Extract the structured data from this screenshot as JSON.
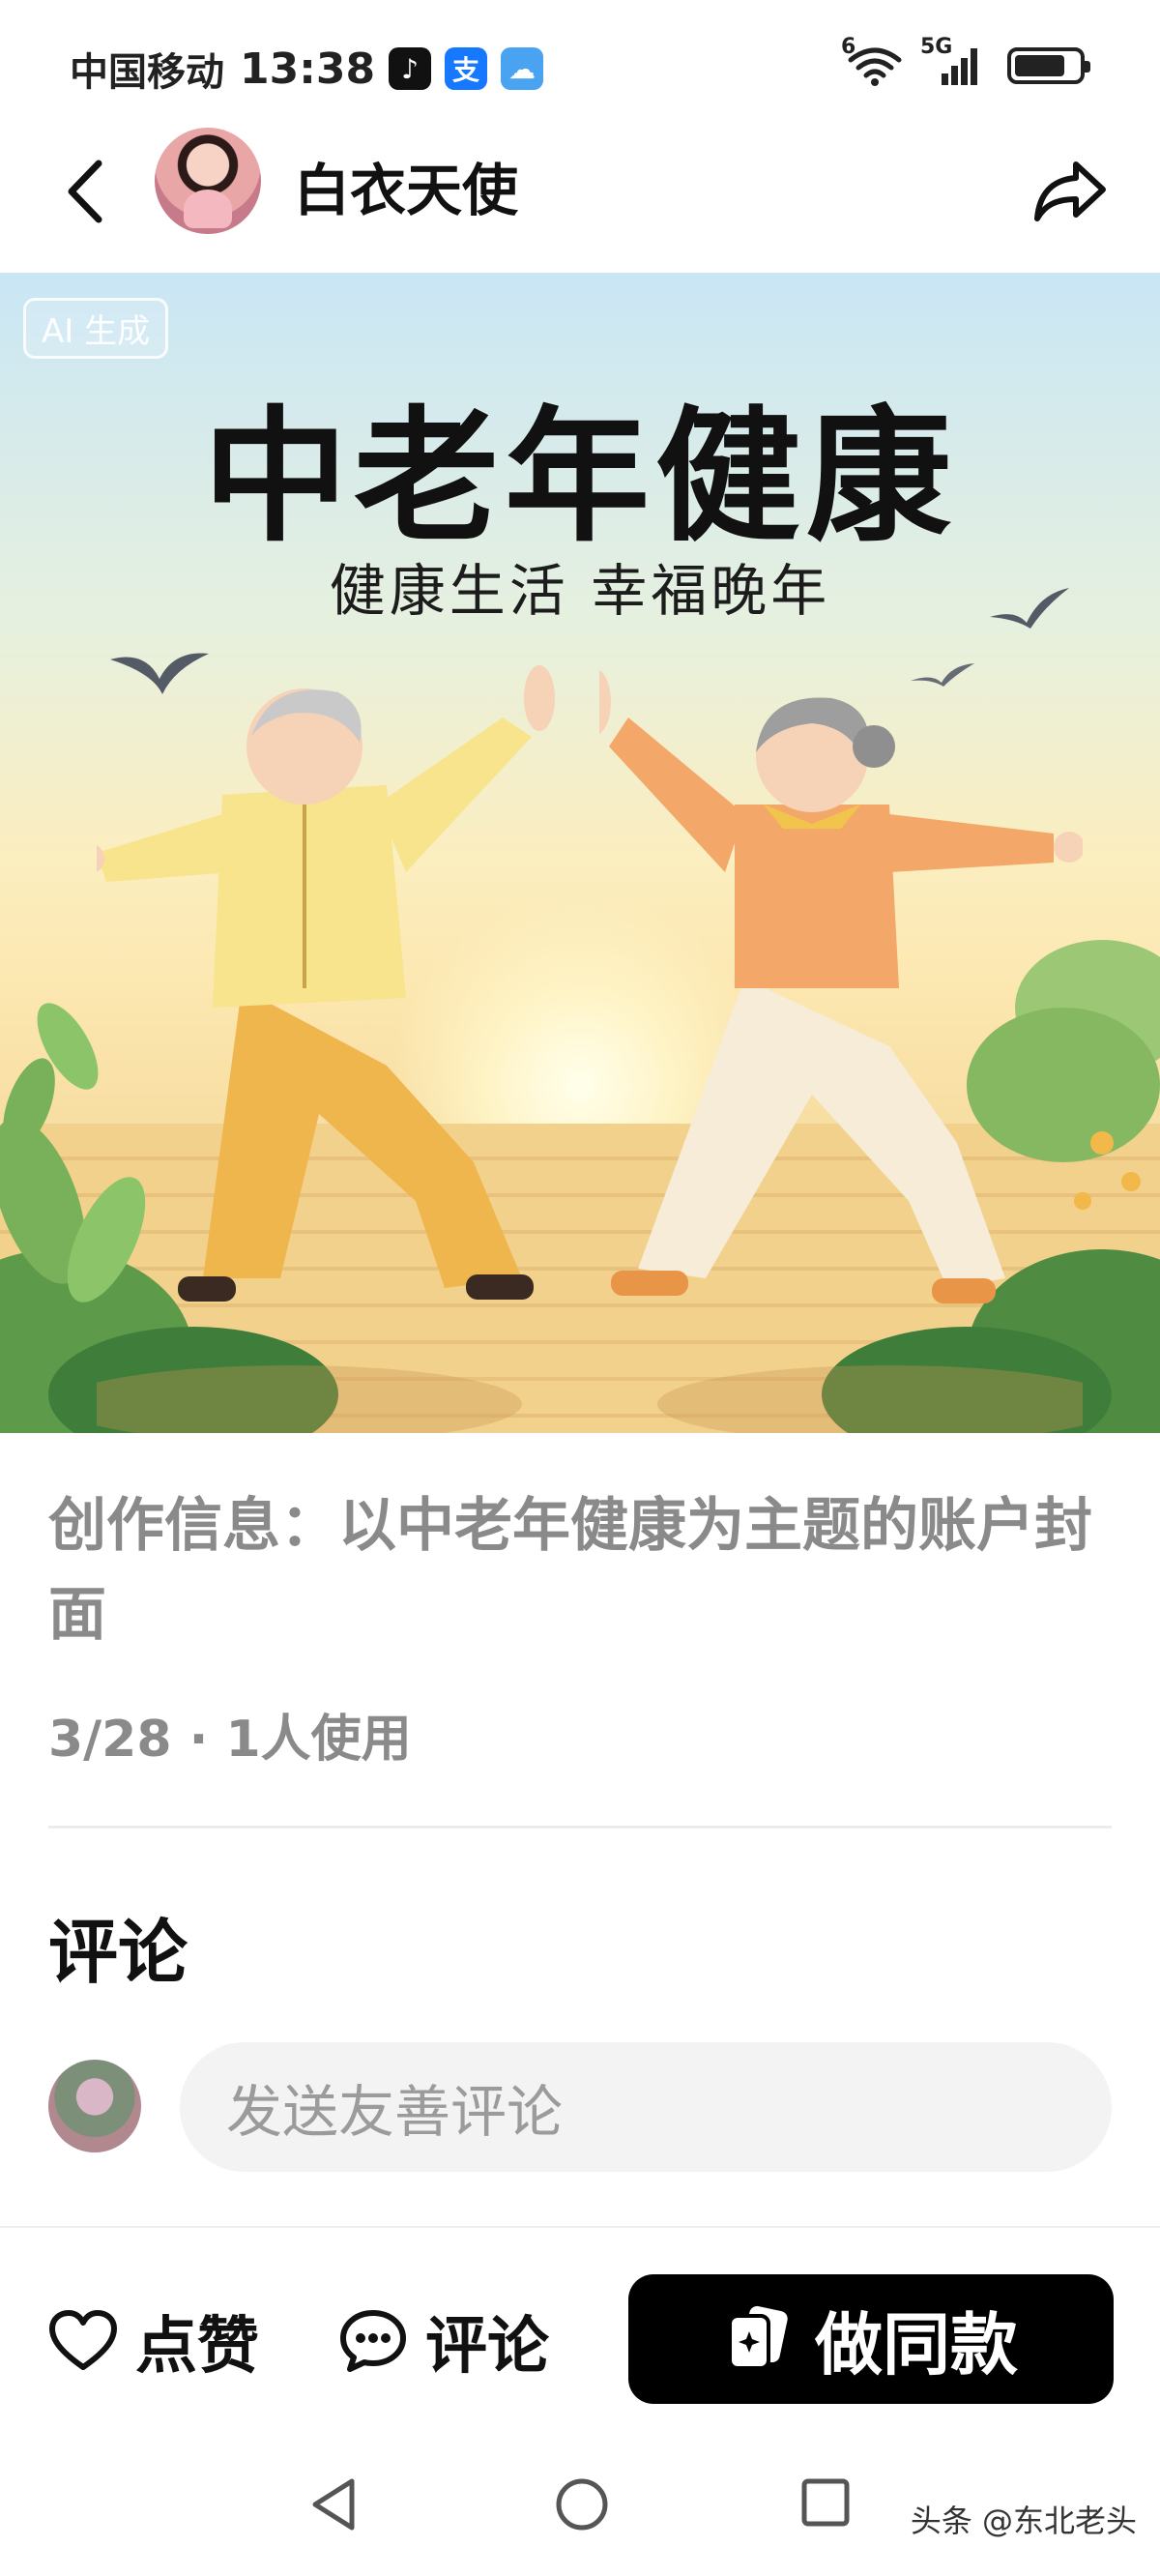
{
  "status_bar": {
    "carrier": "中国移动",
    "time": "13:38",
    "apps": [
      {
        "icon": "tiktok-icon",
        "glyph": "♪"
      },
      {
        "icon": "alipay-icon",
        "glyph": "支"
      },
      {
        "icon": "weather-icon",
        "glyph": "☁"
      }
    ],
    "wifi_label": "6",
    "network": "5G",
    "battery_level": 0.8
  },
  "header": {
    "author_name": "白衣天使"
  },
  "cover": {
    "badge": "AI 生成",
    "title": "中老年健康",
    "subtitle": "健康生活 幸福晚年"
  },
  "info": {
    "text": "创作信息：以中老年健康为主题的账户封面",
    "meta": "3/28 · 1人使用"
  },
  "comments": {
    "title": "评论",
    "input_placeholder": "发送友善评论"
  },
  "actions": {
    "like_label": "点赞",
    "comment_label": "评论",
    "make_same_label": "做同款"
  },
  "watermark": "头条 @东北老头",
  "colors": {
    "accent": "#000000",
    "muted_text": "#8a8a8a",
    "input_bg": "#f3f3f3"
  }
}
